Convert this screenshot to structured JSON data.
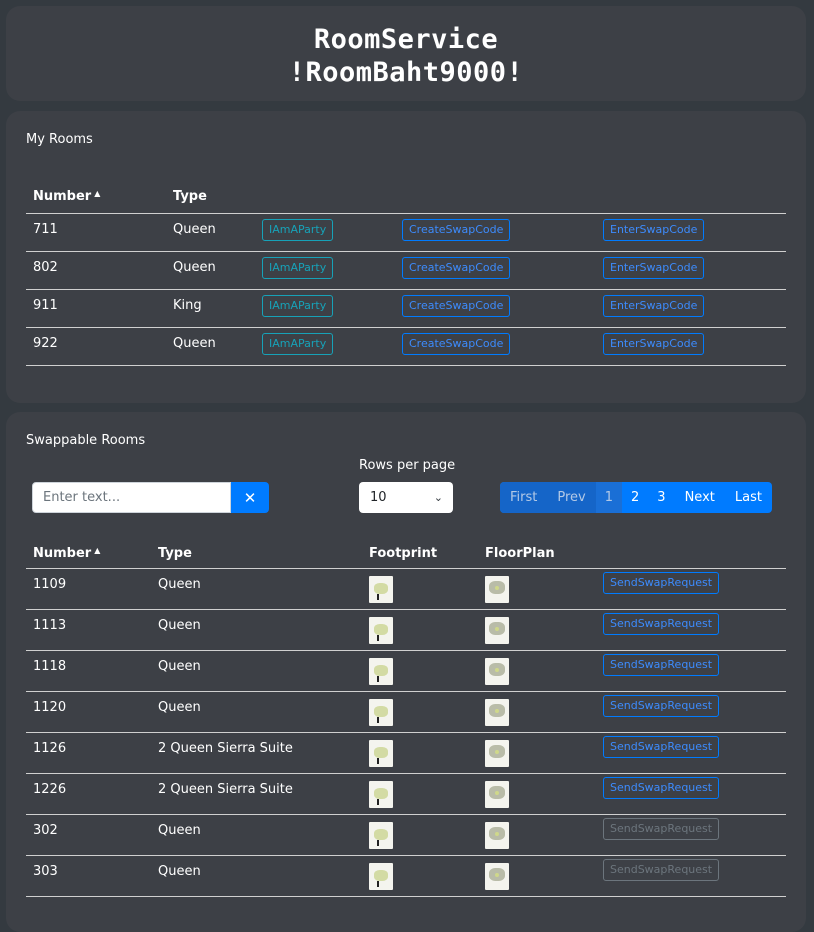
{
  "header": {
    "line1": "RoomService",
    "line2": "!RoomBaht9000!"
  },
  "my_rooms": {
    "title": "My Rooms",
    "columns": {
      "number": "Number",
      "type": "Type"
    },
    "rows": [
      {
        "number": "711",
        "type": "Queen",
        "party": "IAmAParty",
        "create": "CreateSwapCode",
        "enter": "EnterSwapCode"
      },
      {
        "number": "802",
        "type": "Queen",
        "party": "IAmAParty",
        "create": "CreateSwapCode",
        "enter": "EnterSwapCode"
      },
      {
        "number": "911",
        "type": "King",
        "party": "IAmAParty",
        "create": "CreateSwapCode",
        "enter": "EnterSwapCode"
      },
      {
        "number": "922",
        "type": "Queen",
        "party": "IAmAParty",
        "create": "CreateSwapCode",
        "enter": "EnterSwapCode"
      }
    ]
  },
  "swappable": {
    "title": "Swappable Rooms",
    "search": {
      "placeholder": "Enter text...",
      "value": "",
      "clear": "✕"
    },
    "rows_per_page": {
      "label": "Rows per page",
      "value": "10"
    },
    "pagination": {
      "first": "First",
      "prev": "Prev",
      "pages": [
        "1",
        "2",
        "3"
      ],
      "current": "1",
      "next": "Next",
      "last": "Last"
    },
    "columns": {
      "number": "Number",
      "type": "Type",
      "footprint": "Footprint",
      "floorplan": "FloorPlan"
    },
    "rows": [
      {
        "number": "1109",
        "type": "Queen",
        "action": "SendSwapRequest",
        "enabled": true
      },
      {
        "number": "1113",
        "type": "Queen",
        "action": "SendSwapRequest",
        "enabled": true
      },
      {
        "number": "1118",
        "type": "Queen",
        "action": "SendSwapRequest",
        "enabled": true
      },
      {
        "number": "1120",
        "type": "Queen",
        "action": "SendSwapRequest",
        "enabled": true
      },
      {
        "number": "1126",
        "type": "2 Queen Sierra Suite",
        "action": "SendSwapRequest",
        "enabled": true
      },
      {
        "number": "1226",
        "type": "2 Queen Sierra Suite",
        "action": "SendSwapRequest",
        "enabled": true
      },
      {
        "number": "302",
        "type": "Queen",
        "action": "SendSwapRequest",
        "enabled": false
      },
      {
        "number": "303",
        "type": "Queen",
        "action": "SendSwapRequest",
        "enabled": false
      }
    ]
  }
}
